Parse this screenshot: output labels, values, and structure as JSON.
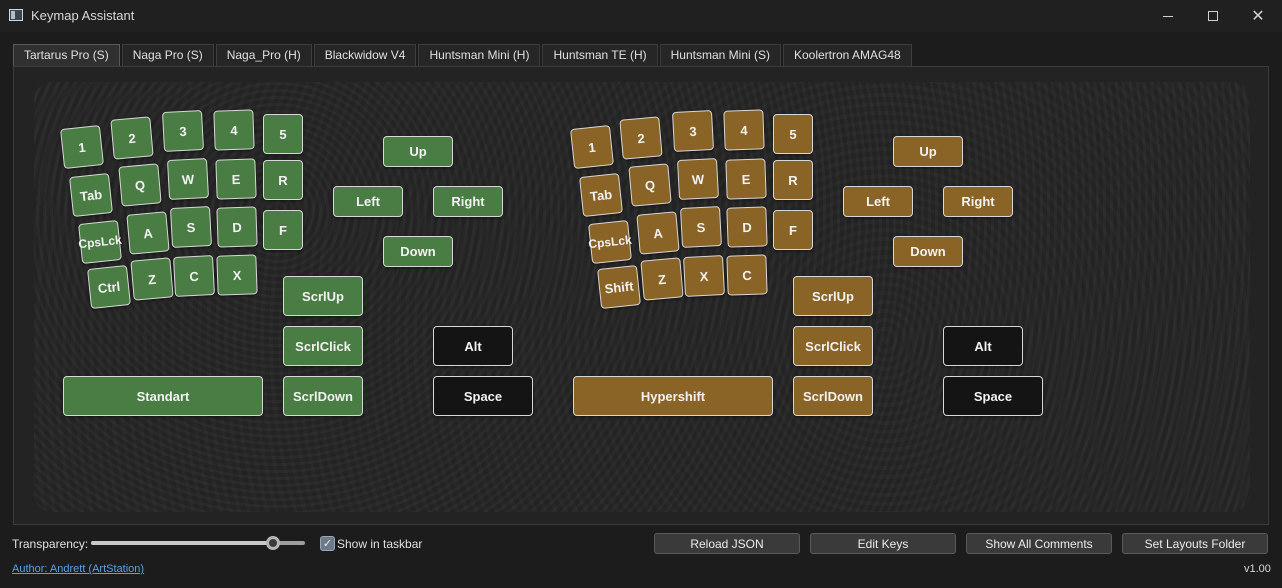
{
  "window": {
    "title": "Keymap Assistant",
    "close_glyph": "✕"
  },
  "tabs": [
    "Tartarus Pro (S)",
    "Naga Pro (S)",
    "Naga_Pro (H)",
    "Blackwidow V4",
    "Huntsman Mini (H)",
    "Huntsman TE (H)",
    "Huntsman Mini (S)",
    "Koolertron AMAG48"
  ],
  "active_tab": "Tartarus Pro (S)",
  "colors": {
    "green_key": "#4a7d44",
    "brown_key": "#8a6326",
    "black_key": "#141414",
    "link": "#5aa0e8"
  },
  "left": {
    "keys": {
      "k1": "1",
      "k2": "2",
      "k3": "3",
      "k4": "4",
      "k5": "5",
      "tab": "Tab",
      "q": "Q",
      "w": "W",
      "e": "E",
      "r": "R",
      "caps": "CpsLck",
      "a": "A",
      "s": "S",
      "d": "D",
      "f": "F",
      "ctrl": "Ctrl",
      "z": "Z",
      "c": "C",
      "x": "X",
      "up": "Up",
      "left": "Left",
      "right": "Right",
      "down": "Down",
      "scrlup": "ScrlUp",
      "scrlclick": "ScrlClick",
      "scrldown": "ScrlDown",
      "alt": "Alt",
      "space": "Space",
      "mode": "Standart"
    }
  },
  "right": {
    "keys": {
      "k1": "1",
      "k2": "2",
      "k3": "3",
      "k4": "4",
      "k5": "5",
      "tab": "Tab",
      "q": "Q",
      "w": "W",
      "e": "E",
      "r": "R",
      "caps": "CpsLck",
      "a": "A",
      "s": "S",
      "d": "D",
      "f": "F",
      "shift": "Shift",
      "z": "Z",
      "x": "X",
      "c": "C",
      "up": "Up",
      "left": "Left",
      "right": "Right",
      "down": "Down",
      "scrlup": "ScrlUp",
      "scrlclick": "ScrlClick",
      "scrldown": "ScrlDown",
      "alt": "Alt",
      "space": "Space",
      "mode": "Hypershift"
    }
  },
  "footer": {
    "transparency_label": "Transparency:",
    "transparency_value": 0.85,
    "show_in_taskbar": "Show in taskbar",
    "show_in_taskbar_checked": true,
    "check_glyph": "✓",
    "buttons": [
      "Reload JSON",
      "Edit Keys",
      "Show All Comments",
      "Set Layouts Folder"
    ],
    "author": "Author: Andrett (ArtStation)",
    "version": "v1.00"
  }
}
